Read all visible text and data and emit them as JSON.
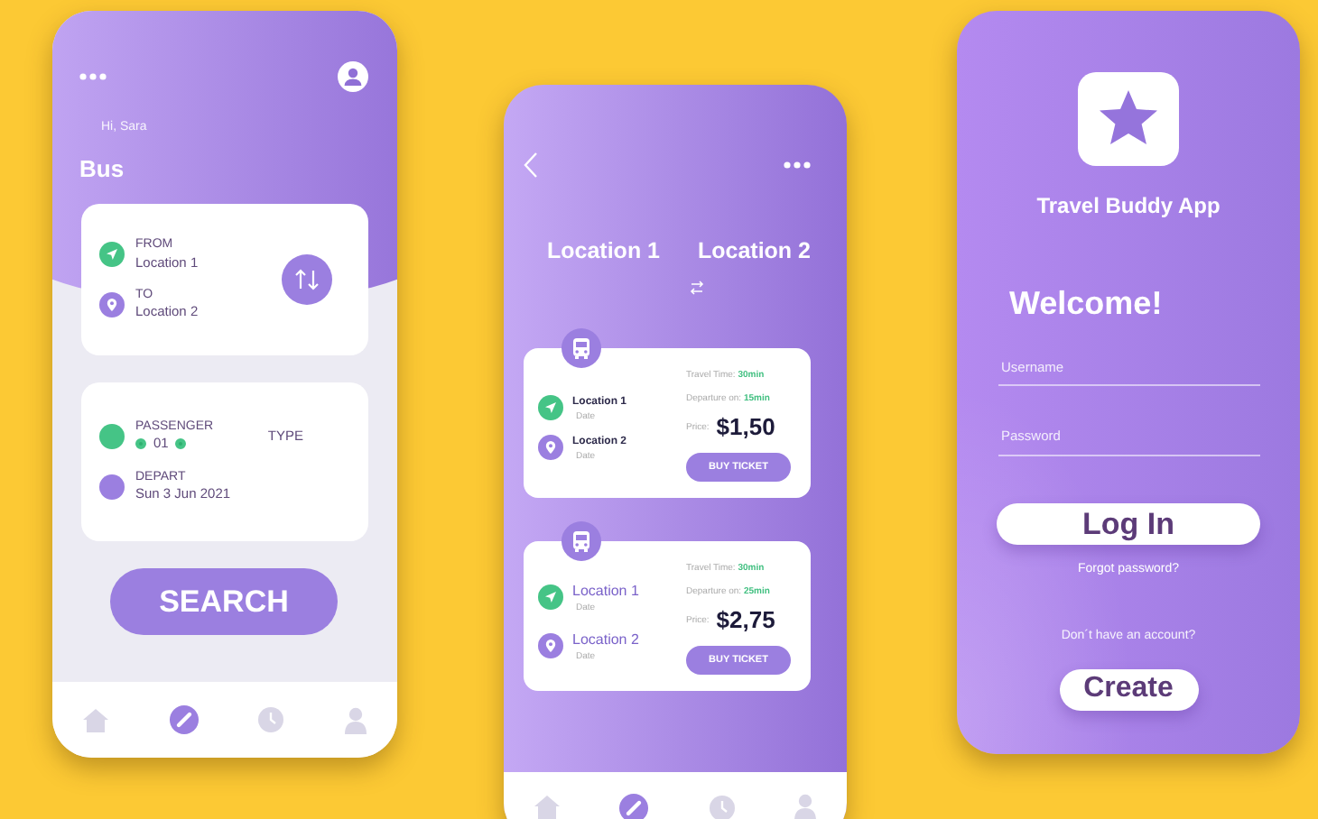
{
  "screens": [
    {
      "kind": "search",
      "greeting": "Hi, Sara",
      "title": "Bus",
      "from": {
        "label": "FROM",
        "value": "Location 1"
      },
      "to": {
        "label": "TO",
        "value": "Location 2"
      },
      "passenger": {
        "label": "PASSENGER",
        "count": "01"
      },
      "type_label": "TYPE",
      "depart": {
        "label": "DEPART",
        "value": "Sun 3 Jun 2021"
      },
      "button": "SEARCH",
      "nav": [
        {
          "selected": false
        },
        {
          "selected": true
        },
        {
          "selected": false
        },
        {
          "selected": false
        }
      ]
    },
    {
      "kind": "results",
      "from": "Location 1",
      "to": "Location 2",
      "tickets": [
        {
          "kind": "compact",
          "from": "Location 1",
          "from_date": "Date",
          "to": "Location 2",
          "to_date": "Date",
          "travel_label": "Travel Time:",
          "travel": "30min",
          "departure_label": "Departure on:",
          "departure": "15min",
          "price_label": "Price:",
          "price": "$1,50",
          "button": "BUY TICKET"
        },
        {
          "kind": "large",
          "from": "Location 1",
          "from_date": "Date",
          "to": "Location 2",
          "to_date": "Date",
          "travel_label": "Travel Time:",
          "travel": "30min",
          "departure_label": "Departure on:",
          "departure": "25min",
          "price_label": "Price:",
          "price": "$2,75",
          "button": "BUY TICKET"
        }
      ],
      "nav": [
        {
          "selected": false
        },
        {
          "selected": true
        },
        {
          "selected": false
        },
        {
          "selected": false
        }
      ]
    },
    {
      "kind": "login",
      "app_name": "Travel Buddy App",
      "welcome": "Welcome!",
      "username": {
        "placeholder": "Username"
      },
      "password": {
        "placeholder": "Password"
      },
      "login_button": "Log In",
      "forgot": "Forgot password?",
      "no_account": "Don´t have an account?",
      "create_button": "Create"
    }
  ]
}
